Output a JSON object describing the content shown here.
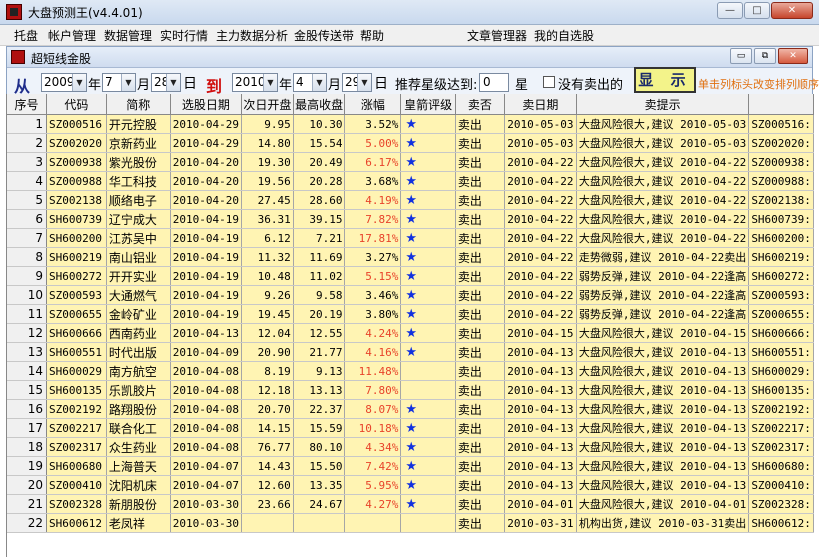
{
  "window": {
    "title": "大盘预测王(v4.4.01)",
    "btn_min": "—",
    "btn_max": "□",
    "btn_close": "✕"
  },
  "menu": [
    "托盘",
    "帐户管理",
    "数据管理",
    "实时行情",
    "主力数据分析",
    "金股传送带",
    "帮助",
    "文章管理器",
    "我的自选股"
  ],
  "child": {
    "title": "超短线金股",
    "btn_min": "▭",
    "btn_restore": "⧉",
    "btn_close": "✕"
  },
  "filter": {
    "from_label": "从",
    "to_label": "到",
    "start_year": "2009",
    "start_month": "7",
    "start_day": "28",
    "end_year": "2010",
    "end_month": "4",
    "end_day": "29",
    "year_unit": "年",
    "month_unit": "月",
    "day_unit": "日",
    "star_label": "推荐星级达到:",
    "star_value": "0",
    "star_unit": "星",
    "unsold_label": "没有卖出的",
    "show_button": "显 示",
    "hint": "单击列标头改变排列顺序"
  },
  "table": {
    "headers": [
      "序号",
      "代码",
      "简称",
      "选股日期",
      "次日开盘",
      "最高收盘",
      "涨幅",
      "皇箭评级",
      "卖否",
      "卖日期",
      "卖提示",
      ""
    ],
    "rows": [
      {
        "idx": "1",
        "code": "SZ000516",
        "name": "开元控股",
        "date": "2010-04-29",
        "open": "9.95",
        "high": "10.30",
        "pct": "3.52%",
        "up": false,
        "star": "★",
        "sold": "卖出",
        "sell_date": "2010-05-03",
        "tip": "大盘风险很大,建议 2010-05-03",
        "extra": "SZ000516:"
      },
      {
        "idx": "2",
        "code": "SZ002020",
        "name": "京新药业",
        "date": "2010-04-29",
        "open": "14.80",
        "high": "15.54",
        "pct": "5.00%",
        "up": true,
        "star": "★",
        "sold": "卖出",
        "sell_date": "2010-05-03",
        "tip": "大盘风险很大,建议 2010-05-03",
        "extra": "SZ002020:"
      },
      {
        "idx": "3",
        "code": "SZ000938",
        "name": "紫光股份",
        "date": "2010-04-20",
        "open": "19.30",
        "high": "20.49",
        "pct": "6.17%",
        "up": true,
        "star": "★",
        "sold": "卖出",
        "sell_date": "2010-04-22",
        "tip": "大盘风险很大,建议 2010-04-22",
        "extra": "SZ000938:"
      },
      {
        "idx": "4",
        "code": "SZ000988",
        "name": "华工科技",
        "date": "2010-04-20",
        "open": "19.56",
        "high": "20.28",
        "pct": "3.68%",
        "up": false,
        "star": "★",
        "sold": "卖出",
        "sell_date": "2010-04-22",
        "tip": "大盘风险很大,建议 2010-04-22",
        "extra": "SZ000988:"
      },
      {
        "idx": "5",
        "code": "SZ002138",
        "name": "顺络电子",
        "date": "2010-04-20",
        "open": "27.45",
        "high": "28.60",
        "pct": "4.19%",
        "up": true,
        "star": "★",
        "sold": "卖出",
        "sell_date": "2010-04-22",
        "tip": "大盘风险很大,建议 2010-04-22",
        "extra": "SZ002138:"
      },
      {
        "idx": "6",
        "code": "SH600739",
        "name": "辽宁成大",
        "date": "2010-04-19",
        "open": "36.31",
        "high": "39.15",
        "pct": "7.82%",
        "up": true,
        "star": "★",
        "sold": "卖出",
        "sell_date": "2010-04-22",
        "tip": "大盘风险很大,建议 2010-04-22",
        "extra": "SH600739:"
      },
      {
        "idx": "7",
        "code": "SH600200",
        "name": "江苏吴中",
        "date": "2010-04-19",
        "open": "6.12",
        "high": "7.21",
        "pct": "17.81%",
        "up": true,
        "star": "★",
        "sold": "卖出",
        "sell_date": "2010-04-22",
        "tip": "大盘风险很大,建议 2010-04-22",
        "extra": "SH600200:"
      },
      {
        "idx": "8",
        "code": "SH600219",
        "name": "南山铝业",
        "date": "2010-04-19",
        "open": "11.32",
        "high": "11.69",
        "pct": "3.27%",
        "up": false,
        "star": "★",
        "sold": "卖出",
        "sell_date": "2010-04-22",
        "tip": "走势微弱,建议 2010-04-22卖出",
        "extra": "SH600219:"
      },
      {
        "idx": "9",
        "code": "SH600272",
        "name": "开开实业",
        "date": "2010-04-19",
        "open": "10.48",
        "high": "11.02",
        "pct": "5.15%",
        "up": true,
        "star": "★",
        "sold": "卖出",
        "sell_date": "2010-04-22",
        "tip": "弱势反弹,建议 2010-04-22逢高",
        "extra": "SH600272:"
      },
      {
        "idx": "10",
        "code": "SZ000593",
        "name": "大通燃气",
        "date": "2010-04-19",
        "open": "9.26",
        "high": "9.58",
        "pct": "3.46%",
        "up": false,
        "star": "★",
        "sold": "卖出",
        "sell_date": "2010-04-22",
        "tip": "弱势反弹,建议 2010-04-22逢高",
        "extra": "SZ000593:"
      },
      {
        "idx": "11",
        "code": "SZ000655",
        "name": "金岭矿业",
        "date": "2010-04-19",
        "open": "19.45",
        "high": "20.19",
        "pct": "3.80%",
        "up": false,
        "star": "★",
        "sold": "卖出",
        "sell_date": "2010-04-22",
        "tip": "弱势反弹,建议 2010-04-22逢高",
        "extra": "SZ000655:"
      },
      {
        "idx": "12",
        "code": "SH600666",
        "name": "西南药业",
        "date": "2010-04-13",
        "open": "12.04",
        "high": "12.55",
        "pct": "4.24%",
        "up": true,
        "star": "★",
        "sold": "卖出",
        "sell_date": "2010-04-15",
        "tip": "大盘风险很大,建议 2010-04-15",
        "extra": "SH600666:"
      },
      {
        "idx": "13",
        "code": "SH600551",
        "name": "时代出版",
        "date": "2010-04-09",
        "open": "20.90",
        "high": "21.77",
        "pct": "4.16%",
        "up": true,
        "star": "★",
        "sold": "卖出",
        "sell_date": "2010-04-13",
        "tip": "大盘风险很大,建议 2010-04-13",
        "extra": "SH600551:"
      },
      {
        "idx": "14",
        "code": "SH600029",
        "name": "南方航空",
        "date": "2010-04-08",
        "open": "8.19",
        "high": "9.13",
        "pct": "11.48%",
        "up": true,
        "star": "",
        "sold": "卖出",
        "sell_date": "2010-04-13",
        "tip": "大盘风险很大,建议 2010-04-13",
        "extra": "SH600029:"
      },
      {
        "idx": "15",
        "code": "SH600135",
        "name": "乐凯胶片",
        "date": "2010-04-08",
        "open": "12.18",
        "high": "13.13",
        "pct": "7.80%",
        "up": true,
        "star": "",
        "sold": "卖出",
        "sell_date": "2010-04-13",
        "tip": "大盘风险很大,建议 2010-04-13",
        "extra": "SH600135:"
      },
      {
        "idx": "16",
        "code": "SZ002192",
        "name": "路翔股份",
        "date": "2010-04-08",
        "open": "20.70",
        "high": "22.37",
        "pct": "8.07%",
        "up": true,
        "star": "★",
        "sold": "卖出",
        "sell_date": "2010-04-13",
        "tip": "大盘风险很大,建议 2010-04-13",
        "extra": "SZ002192:"
      },
      {
        "idx": "17",
        "code": "SZ002217",
        "name": "联合化工",
        "date": "2010-04-08",
        "open": "14.15",
        "high": "15.59",
        "pct": "10.18%",
        "up": true,
        "star": "★",
        "sold": "卖出",
        "sell_date": "2010-04-13",
        "tip": "大盘风险很大,建议 2010-04-13",
        "extra": "SZ002217:"
      },
      {
        "idx": "18",
        "code": "SZ002317",
        "name": "众生药业",
        "date": "2010-04-08",
        "open": "76.77",
        "high": "80.10",
        "pct": "4.34%",
        "up": true,
        "star": "★",
        "sold": "卖出",
        "sell_date": "2010-04-13",
        "tip": "大盘风险很大,建议 2010-04-13",
        "extra": "SZ002317:"
      },
      {
        "idx": "19",
        "code": "SH600680",
        "name": "上海普天",
        "date": "2010-04-07",
        "open": "14.43",
        "high": "15.50",
        "pct": "7.42%",
        "up": true,
        "star": "★",
        "sold": "卖出",
        "sell_date": "2010-04-13",
        "tip": "大盘风险很大,建议 2010-04-13",
        "extra": "SH600680:"
      },
      {
        "idx": "20",
        "code": "SZ000410",
        "name": "沈阳机床",
        "date": "2010-04-07",
        "open": "12.60",
        "high": "13.35",
        "pct": "5.95%",
        "up": true,
        "star": "★",
        "sold": "卖出",
        "sell_date": "2010-04-13",
        "tip": "大盘风险很大,建议 2010-04-13",
        "extra": "SZ000410:"
      },
      {
        "idx": "21",
        "code": "SZ002328",
        "name": "新朋股份",
        "date": "2010-03-30",
        "open": "23.66",
        "high": "24.67",
        "pct": "4.27%",
        "up": true,
        "star": "★",
        "sold": "卖出",
        "sell_date": "2010-04-01",
        "tip": "大盘风险很大,建议 2010-04-01",
        "extra": "SZ002328:"
      },
      {
        "idx": "22",
        "code": "SH600612",
        "name": "老凤祥",
        "date": "2010-03-30",
        "open": "",
        "high": "",
        "pct": "",
        "up": false,
        "star": "",
        "sold": "卖出",
        "sell_date": "2010-03-31",
        "tip": "机构出货,建议 2010-03-31卖出",
        "extra": "SH600612:"
      }
    ]
  }
}
